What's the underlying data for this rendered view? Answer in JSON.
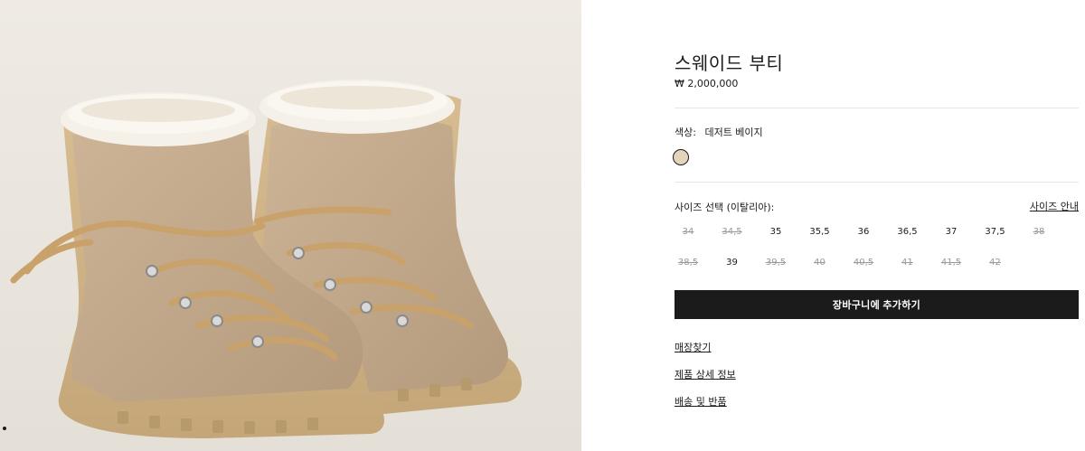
{
  "product": {
    "title": "스웨이드 부티",
    "price": "₩ 2,000,000",
    "image_alt": "boots-image"
  },
  "color": {
    "label": "색상:",
    "value": "데저트 베이지",
    "swatch_color": "#e3d4bb"
  },
  "size": {
    "label": "사이즈 선택 (이탈리아):",
    "guide_label": "사이즈 안내",
    "options": [
      {
        "label": "34",
        "available": false
      },
      {
        "label": "34,5",
        "available": false
      },
      {
        "label": "35",
        "available": true
      },
      {
        "label": "35,5",
        "available": true
      },
      {
        "label": "36",
        "available": true
      },
      {
        "label": "36,5",
        "available": true
      },
      {
        "label": "37",
        "available": true
      },
      {
        "label": "37,5",
        "available": true
      },
      {
        "label": "38",
        "available": false
      },
      {
        "label": "38,5",
        "available": false
      },
      {
        "label": "39",
        "available": true
      },
      {
        "label": "39,5",
        "available": false
      },
      {
        "label": "40",
        "available": false
      },
      {
        "label": "40,5",
        "available": false
      },
      {
        "label": "41",
        "available": false
      },
      {
        "label": "41,5",
        "available": false
      },
      {
        "label": "42",
        "available": false
      }
    ]
  },
  "actions": {
    "add_to_cart": "장바구니에 추가하기"
  },
  "links": [
    {
      "label": "매장찾기"
    },
    {
      "label": "제품 상세 정보"
    },
    {
      "label": "배송 및 반품"
    }
  ],
  "colors": {
    "primary": "#1b1b1b",
    "image_background": "#ece8e1",
    "disabled_text": "#9a9a9a"
  }
}
